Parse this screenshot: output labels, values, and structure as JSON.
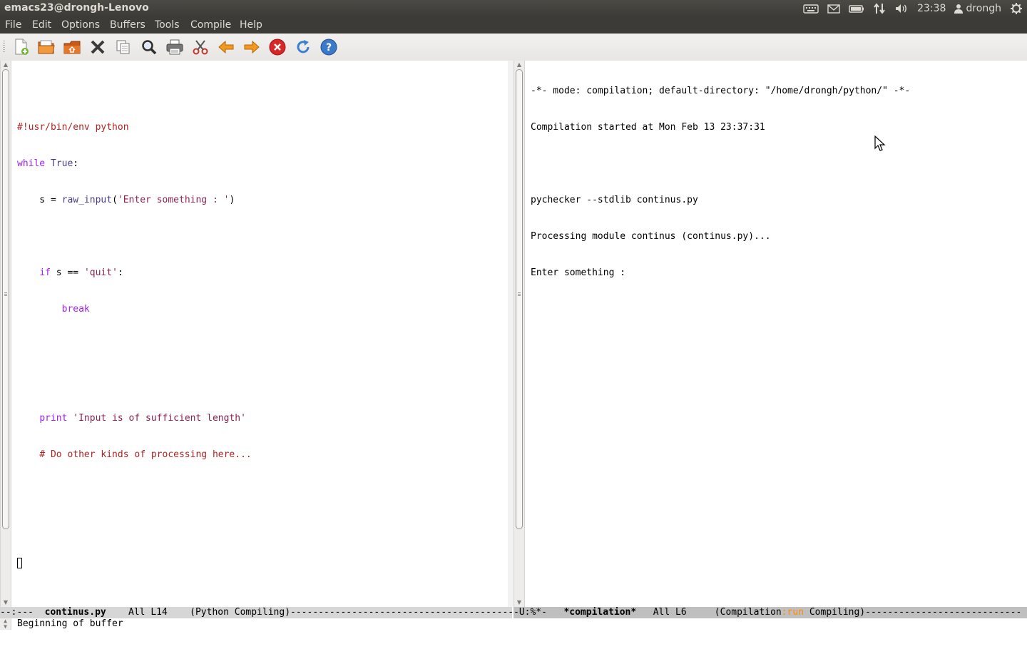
{
  "window": {
    "title": "emacs23@drongh-Lenovo"
  },
  "tray": {
    "time": "23:38",
    "user": "drongh",
    "icons": [
      "keyboard-icon",
      "mail-icon",
      "battery-icon",
      "network-updown-icon",
      "volume-icon",
      "user-icon",
      "power-gear-icon"
    ]
  },
  "menu": [
    "File",
    "Edit",
    "Options",
    "Buffers",
    "Tools",
    "Compile",
    "Help"
  ],
  "toolbar": {
    "icons": [
      "new-file-icon",
      "open-folder-icon",
      "open-directory-icon",
      "close-x-icon",
      "copy-icon",
      "search-magnifier-icon",
      "print-icon",
      "cut-scissors-icon",
      "back-arrow-icon",
      "forward-arrow-icon",
      "stop-red-icon",
      "refresh-icon",
      "help-question-icon"
    ]
  },
  "left_buffer": {
    "lines": [
      "",
      "#!usr/bin/env python",
      "while True:",
      "    s = raw_input('Enter something : ')",
      "",
      "    if s == 'quit':",
      "        break",
      "",
      "",
      "    print 'Input is of sufficient length'",
      "    # Do other kinds of processing here...",
      "",
      "",
      ""
    ]
  },
  "right_buffer": {
    "lines": [
      "-*- mode: compilation; default-directory: \"/home/drongh/python/\" -*-",
      "Compilation started at Mon Feb 13 23:37:31",
      "",
      "pychecker --stdlib continus.py",
      "Processing module continus (continus.py)...",
      "Enter something :"
    ]
  },
  "modeline_left": {
    "status": "--:---",
    "buffer_name": "continus.py",
    "position": "All L14",
    "modes": "(Python Compiling)",
    "fill": "----------------------------------------"
  },
  "modeline_right": {
    "status": "-U:%*-",
    "buffer_name": "*compilation*",
    "position": "All L6",
    "mode_open": "(Compilation",
    "mode_run": ":run",
    "mode_close": " Compiling)",
    "fill": "----------------------------"
  },
  "minibuffer": {
    "message": "Beginning of buffer"
  },
  "colors": {
    "keyword": "#a020f0",
    "string": "#8b2252",
    "comment": "#b22222",
    "builtin": "#483d8b",
    "run_status": "#ff8c00"
  }
}
